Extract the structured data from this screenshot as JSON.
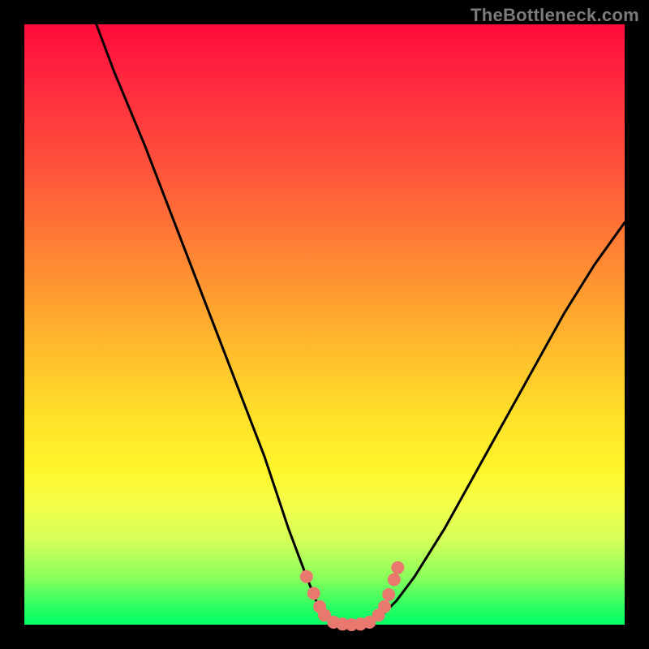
{
  "watermark": "TheBottleneck.com",
  "chart_data": {
    "type": "line",
    "title": "",
    "xlabel": "",
    "ylabel": "",
    "xlim": [
      0,
      100
    ],
    "ylim": [
      0,
      100
    ],
    "grid": false,
    "legend": false,
    "series": [
      {
        "name": "left-curve",
        "x": [
          12,
          15,
          20,
          25,
          30,
          35,
          40,
          44,
          47,
          49,
          50,
          52,
          54
        ],
        "y": [
          100,
          92,
          80,
          67,
          54,
          41,
          28,
          16,
          8,
          3,
          1,
          0.3,
          0
        ]
      },
      {
        "name": "right-curve",
        "x": [
          54,
          56,
          58,
          60,
          62,
          65,
          70,
          75,
          80,
          85,
          90,
          95,
          100
        ],
        "y": [
          0,
          0.2,
          0.8,
          2,
          4,
          8,
          16,
          25,
          34,
          43,
          52,
          60,
          67
        ]
      }
    ],
    "markers": {
      "name": "highlight-dots",
      "color": "#e9786f",
      "points": [
        {
          "x": 47.0,
          "y": 8.0
        },
        {
          "x": 48.2,
          "y": 5.2
        },
        {
          "x": 49.2,
          "y": 3.0
        },
        {
          "x": 50.0,
          "y": 1.6
        },
        {
          "x": 51.5,
          "y": 0.4
        },
        {
          "x": 53.0,
          "y": 0.1
        },
        {
          "x": 54.5,
          "y": 0.0
        },
        {
          "x": 56.0,
          "y": 0.1
        },
        {
          "x": 57.5,
          "y": 0.4
        },
        {
          "x": 59.0,
          "y": 1.6
        },
        {
          "x": 60.0,
          "y": 3.0
        },
        {
          "x": 60.7,
          "y": 5.0
        },
        {
          "x": 61.6,
          "y": 7.5
        },
        {
          "x": 62.2,
          "y": 9.5
        }
      ]
    },
    "gradient_stops": [
      {
        "pos": 0,
        "color": "#ff0b3a"
      },
      {
        "pos": 26,
        "color": "#ff5a3a"
      },
      {
        "pos": 53,
        "color": "#ffb82c"
      },
      {
        "pos": 74,
        "color": "#fff52a"
      },
      {
        "pos": 92,
        "color": "#8cff5a"
      },
      {
        "pos": 100,
        "color": "#00ff66"
      }
    ]
  }
}
